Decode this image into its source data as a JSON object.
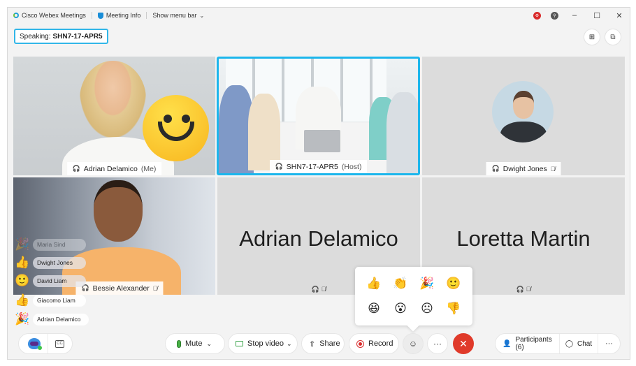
{
  "titlebar": {
    "app_name": "Cisco Webex Meetings",
    "meeting_info": "Meeting Info",
    "show_menu_bar": "Show menu bar",
    "chevron": "⌄",
    "minimize": "–",
    "maximize": "☐",
    "close": "✕",
    "notification_icon": "⚙",
    "status_icon": "⚲"
  },
  "speaking": {
    "label": "Speaking:",
    "name": "SHN7-17-APR5"
  },
  "view_buttons": {
    "grid_icon": "⊞",
    "layout_icon": "⧉"
  },
  "participants": [
    {
      "name": "Adrian Delamico",
      "suffix": "(Me)",
      "muted": false,
      "reaction": "smile"
    },
    {
      "name": "SHN7-17-APR5",
      "suffix": "(Host)",
      "muted": false,
      "active_speaker": true
    },
    {
      "name": "Dwight Jones",
      "suffix": "",
      "muted": true
    },
    {
      "name": "Bessie Alexander",
      "suffix": "",
      "muted": true
    },
    {
      "name": "Adrian Delamico",
      "suffix": "",
      "muted": true,
      "video_off": true
    },
    {
      "name": "Loretta Martin",
      "suffix": "",
      "muted": true,
      "video_off": true
    }
  ],
  "icons": {
    "headset": "🎧",
    "mic_off": "🎙̸"
  },
  "reaction_feed": [
    {
      "emoji": "🎉",
      "name": "Maria Sind",
      "state": "faded"
    },
    {
      "emoji": "👍",
      "name": "Dwight Jones",
      "state": "dim"
    },
    {
      "emoji": "🙂",
      "name": "David Liam",
      "state": "dim"
    },
    {
      "emoji": "👍",
      "name": "Giacomo Liam",
      "state": "normal"
    },
    {
      "emoji": "🎉",
      "name": "Adrian Delamico",
      "state": "normal"
    }
  ],
  "reactions_popup": [
    {
      "name": "thumbs-up",
      "glyph": "👍"
    },
    {
      "name": "clap",
      "glyph": "👏"
    },
    {
      "name": "celebrate",
      "glyph": "🎉"
    },
    {
      "name": "smile",
      "glyph": "🙂"
    },
    {
      "name": "haha",
      "glyph": "😆"
    },
    {
      "name": "surprised",
      "glyph": "😮"
    },
    {
      "name": "sad",
      "glyph": "☹"
    },
    {
      "name": "thumbs-down",
      "glyph": "👎"
    }
  ],
  "toolbar": {
    "mute": "Mute",
    "stop_video": "Stop video",
    "share": "Share",
    "record": "Record",
    "more": "···",
    "end": "✕",
    "participants": "Participants (6)",
    "chat": "Chat",
    "dropdown": "⌄",
    "share_icon": "⇧",
    "reactions_icon": "☺",
    "cc_label": "CC",
    "participants_icon": "👤",
    "chat_icon": "◯"
  },
  "colors": {
    "accent": "#1cb6ec",
    "end_call": "#e03a2a",
    "mic_green": "#48b146",
    "record_red": "#d92b2b"
  }
}
